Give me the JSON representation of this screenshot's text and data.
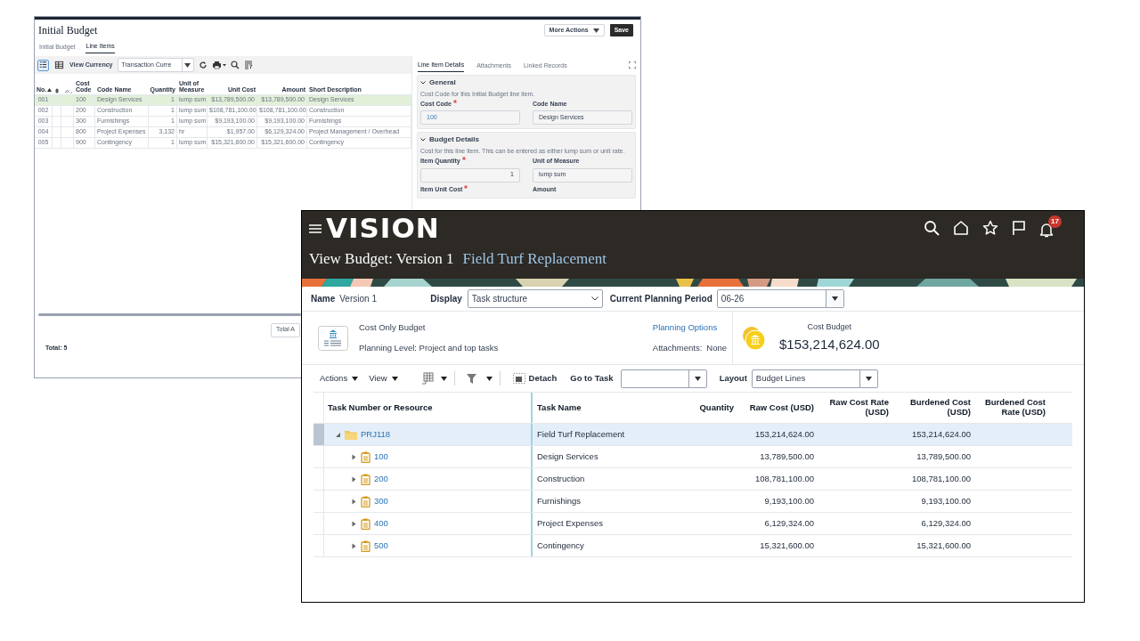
{
  "back_window": {
    "title": "Initial Budget",
    "header_buttons": [
      {
        "label": "More Actions",
        "kind": "menu"
      },
      {
        "label": "Save",
        "kind": "primary"
      }
    ],
    "tabs": [
      {
        "label": "Initial Budget",
        "selected": false
      },
      {
        "label": "Line Items",
        "selected": true
      }
    ],
    "view_modes": [
      {
        "kind": "list",
        "selected": true
      },
      {
        "kind": "table",
        "selected": false
      }
    ],
    "view_currency_label": "View Currency",
    "currency": "Transaction Curre",
    "table": {
      "columns": [
        {
          "kind": "text",
          "label": "No.",
          "sorted": true
        },
        {
          "kind": "attachment"
        },
        {
          "kind": "link"
        },
        {
          "kind": "text",
          "label": "Cost Code"
        },
        {
          "kind": "text",
          "label": "Code Name"
        },
        {
          "kind": "number",
          "label": "Quantity"
        },
        {
          "kind": "text",
          "label": "Unit of Measure"
        },
        {
          "kind": "number",
          "label": "Unit Cost"
        },
        {
          "kind": "number",
          "label": "Amount"
        },
        {
          "kind": "text",
          "label": "Short Description"
        }
      ],
      "rows": [
        {
          "selected": true,
          "cells": [
            "001",
            "",
            "",
            "100",
            "Design Services",
            "1",
            "lump sum",
            "$13,789,500.00",
            "$13,789,500.00",
            "Design Services"
          ]
        },
        {
          "selected": false,
          "cells": [
            "002",
            "",
            "",
            "200",
            "Construction",
            "1",
            "lump sum",
            "$108,781,100.00",
            "$108,781,100.00",
            "Construction"
          ]
        },
        {
          "selected": false,
          "cells": [
            "003",
            "",
            "",
            "300",
            "Furnishings",
            "1",
            "lump sum",
            "$9,193,100.00",
            "$9,193,100.00",
            "Furnishings"
          ]
        },
        {
          "selected": false,
          "cells": [
            "004",
            "",
            "",
            "800",
            "Project Expenses",
            "3,132",
            "hr",
            "$1,957.00",
            "$6,129,324.00",
            "Project Management / Overhead"
          ]
        },
        {
          "selected": false,
          "cells": [
            "005",
            "",
            "",
            "900",
            "Contingency",
            "1",
            "lump sum",
            "$15,321,600.00",
            "$15,321,600.00",
            "Contingency"
          ]
        }
      ]
    },
    "total_button": "Total A",
    "total": "Total: 5",
    "detail_panel": {
      "tabs": [
        {
          "label": "Line Item Details",
          "selected": true
        },
        {
          "label": "Attachments",
          "selected": false
        },
        {
          "label": "Linked Records",
          "selected": false
        }
      ],
      "sections": [
        {
          "title": "General",
          "expanded": true,
          "description": "Cost Code for this Initial Budget line item.",
          "fields": [
            {
              "label": "Cost Code",
              "required": true,
              "kind": "link",
              "value": "100"
            },
            {
              "label": "Code Name",
              "required": false,
              "kind": "text",
              "value": "Design Services"
            }
          ]
        },
        {
          "title": "Budget Details",
          "expanded": true,
          "description": "Cost for this line item. This can be entered as either lump sum or unit rate.",
          "fields": [
            {
              "label": "Item Quantity",
              "required": true,
              "kind": "number",
              "value": "1"
            },
            {
              "label": "Unit of Measure",
              "required": false,
              "kind": "text",
              "value": "lump sum"
            },
            {
              "label": "Item Unit Cost",
              "required": true
            },
            {
              "label": "Amount",
              "required": false
            }
          ]
        }
      ]
    }
  },
  "front_window": {
    "logo": "VISION",
    "notifications": "17",
    "title": "View Budget: Version 1",
    "project": "Field Turf Replacement",
    "name_label": "Name",
    "name": "Version 1",
    "display_label": "Display",
    "display": "Task structure",
    "period_label": "Current Planning Period",
    "period": "06-26",
    "budget_type": "Cost Only Budget",
    "planning_level": "Planning Level: Project and top tasks",
    "planning_options": "Planning Options",
    "attachments_label": "Attachments:",
    "attachments": "None",
    "cost_budget_label": "Cost Budget",
    "cost_budget": "$153,214,624.00",
    "toolbar": {
      "actions": "Actions",
      "view": "View",
      "detach": "Detach",
      "go_to_task": "Go to Task",
      "layout_label": "Layout",
      "layout": "Budget Lines"
    },
    "table": {
      "columns": [
        "Task Number or Resource",
        "Task Name",
        "Quantity",
        "Raw Cost (USD)",
        "Raw Cost Rate (USD)",
        "Burdened Cost (USD)",
        "Burdened Cost Rate (USD)"
      ],
      "rows": [
        {
          "kind": "project",
          "task": "PRJ118",
          "name": "Field Turf Replacement",
          "raw_cost": "153,214,624.00",
          "burdened_cost": "153,214,624.00",
          "expanded": true,
          "selected": true,
          "children": [
            {
              "kind": "task",
              "task": "100",
              "name": "Design Services",
              "raw_cost": "13,789,500.00",
              "burdened_cost": "13,789,500.00",
              "expanded": false,
              "selected": false
            },
            {
              "kind": "task",
              "task": "200",
              "name": "Construction",
              "raw_cost": "108,781,100.00",
              "burdened_cost": "108,781,100.00",
              "expanded": false,
              "selected": false
            },
            {
              "kind": "task",
              "task": "300",
              "name": "Furnishings",
              "raw_cost": "9,193,100.00",
              "burdened_cost": "9,193,100.00",
              "expanded": false,
              "selected": false
            },
            {
              "kind": "task",
              "task": "400",
              "name": "Project Expenses",
              "raw_cost": "6,129,324.00",
              "burdened_cost": "6,129,324.00",
              "expanded": false,
              "selected": false
            },
            {
              "kind": "task",
              "task": "500",
              "name": "Contingency",
              "raw_cost": "15,321,600.00",
              "burdened_cost": "15,321,600.00",
              "expanded": false,
              "selected": false
            }
          ]
        }
      ]
    }
  }
}
